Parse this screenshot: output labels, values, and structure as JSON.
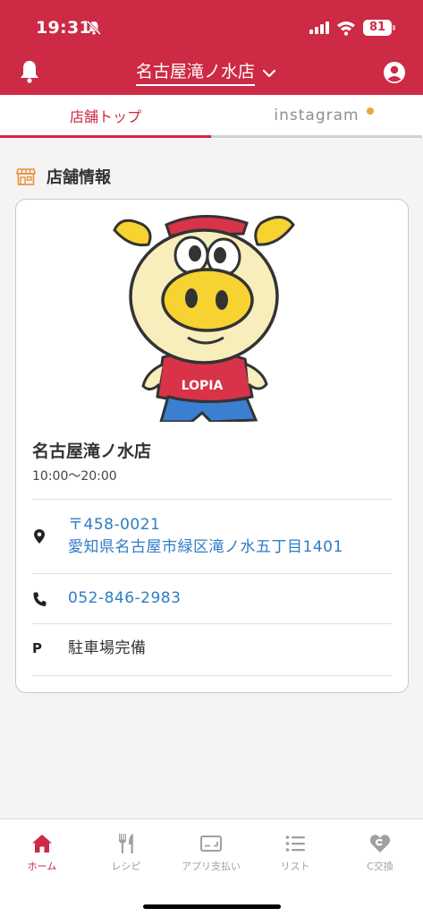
{
  "status": {
    "time": "19:31",
    "battery": "81"
  },
  "header": {
    "store_selector": "名古屋滝ノ水店"
  },
  "tabs": [
    {
      "label": "店舗トップ",
      "active": true
    },
    {
      "label": "instagram",
      "active": false,
      "has_badge": true
    }
  ],
  "section": {
    "title": "店舗情報"
  },
  "store": {
    "name": "名古屋滝ノ水店",
    "hours": "10:00〜20:00",
    "postal": "〒458-0021",
    "address": "愛知県名古屋市緑区滝ノ水五丁目1401",
    "phone": "052-846-2983",
    "parking": "駐車場完備",
    "mascot_shirt_text": "LOPIA"
  },
  "bottom_nav": [
    {
      "label": "ホーム",
      "icon": "home-icon",
      "active": true
    },
    {
      "label": "レシピ",
      "icon": "fork-knife-icon",
      "active": false
    },
    {
      "label": "アプリ支払い",
      "icon": "payment-card-icon",
      "active": false
    },
    {
      "label": "リスト",
      "icon": "list-icon",
      "active": false
    },
    {
      "label": "C交換",
      "icon": "heart-exchange-icon",
      "active": false
    }
  ],
  "colors": {
    "brand": "#cc2a45",
    "link": "#2f7cc6",
    "badge": "#f1a23a",
    "store_icon": "#e8913a"
  }
}
